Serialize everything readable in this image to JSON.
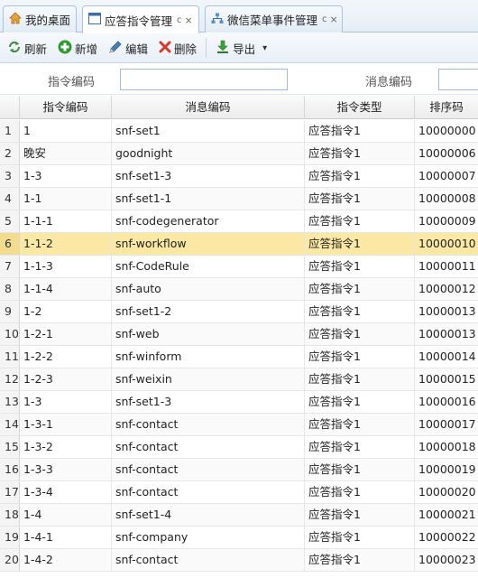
{
  "tabs": [
    {
      "label": "我的桌面",
      "icon": "home-icon"
    },
    {
      "label": "应答指令管理",
      "icon": "window-icon",
      "extra": "c",
      "close": "×"
    },
    {
      "label": "微信菜单事件管理",
      "icon": "sitemap-icon",
      "extra": "c",
      "close": "×"
    }
  ],
  "toolbar": {
    "refresh_label": "刷新",
    "add_label": "新增",
    "edit_label": "编辑",
    "delete_label": "删除",
    "export_label": "导出",
    "caret": "▾"
  },
  "search": {
    "field1_label": "指令编码",
    "field1_value": "",
    "field2_label": "消息编码",
    "field2_value": ""
  },
  "grid": {
    "columns": [
      "指令编码",
      "消息编码",
      "指令类型",
      "排序码"
    ],
    "selected_row": 6,
    "rows": [
      {
        "num": "1",
        "code": "1",
        "msg": "snf-set1",
        "type": "应答指令1",
        "sort": "10000000"
      },
      {
        "num": "2",
        "code": "晚安",
        "msg": "goodnight",
        "type": "应答指令1",
        "sort": "10000006"
      },
      {
        "num": "3",
        "code": "1-3",
        "msg": "snf-set1-3",
        "type": "应答指令1",
        "sort": "10000007"
      },
      {
        "num": "4",
        "code": "1-1",
        "msg": "snf-set1-1",
        "type": "应答指令1",
        "sort": "10000008"
      },
      {
        "num": "5",
        "code": "1-1-1",
        "msg": "snf-codegenerator",
        "type": "应答指令1",
        "sort": "10000009"
      },
      {
        "num": "6",
        "code": "1-1-2",
        "msg": "snf-workflow",
        "type": "应答指令1",
        "sort": "10000010"
      },
      {
        "num": "7",
        "code": "1-1-3",
        "msg": "snf-CodeRule",
        "type": "应答指令1",
        "sort": "10000011"
      },
      {
        "num": "8",
        "code": "1-1-4",
        "msg": "snf-auto",
        "type": "应答指令1",
        "sort": "10000012"
      },
      {
        "num": "9",
        "code": "1-2",
        "msg": "snf-set1-2",
        "type": "应答指令1",
        "sort": "10000013"
      },
      {
        "num": "10",
        "code": "1-2-1",
        "msg": "snf-web",
        "type": "应答指令1",
        "sort": "10000013"
      },
      {
        "num": "11",
        "code": "1-2-2",
        "msg": "snf-winform",
        "type": "应答指令1",
        "sort": "10000014"
      },
      {
        "num": "12",
        "code": "1-2-3",
        "msg": "snf-weixin",
        "type": "应答指令1",
        "sort": "10000015"
      },
      {
        "num": "13",
        "code": "1-3",
        "msg": "snf-set1-3",
        "type": "应答指令1",
        "sort": "10000016"
      },
      {
        "num": "14",
        "code": "1-3-1",
        "msg": "snf-contact",
        "type": "应答指令1",
        "sort": "10000017"
      },
      {
        "num": "15",
        "code": "1-3-2",
        "msg": "snf-contact",
        "type": "应答指令1",
        "sort": "10000018"
      },
      {
        "num": "16",
        "code": "1-3-3",
        "msg": "snf-contact",
        "type": "应答指令1",
        "sort": "10000019"
      },
      {
        "num": "17",
        "code": "1-3-4",
        "msg": "snf-contact",
        "type": "应答指令1",
        "sort": "10000020"
      },
      {
        "num": "18",
        "code": "1-4",
        "msg": "snf-set1-4",
        "type": "应答指令1",
        "sort": "10000021"
      },
      {
        "num": "19",
        "code": "1-4-1",
        "msg": "snf-company",
        "type": "应答指令1",
        "sort": "10000022"
      },
      {
        "num": "20",
        "code": "1-4-2",
        "msg": "snf-contact",
        "type": "应答指令1",
        "sort": "10000023"
      }
    ]
  },
  "colors": {
    "selected_row": "#fbe8a4",
    "accent": "#a9c3dd",
    "refresh_icon": "#3c8a3c",
    "add_icon": "#2e9a2e",
    "delete_icon": "#d23a2a",
    "export_icon": "#3aa03a"
  }
}
